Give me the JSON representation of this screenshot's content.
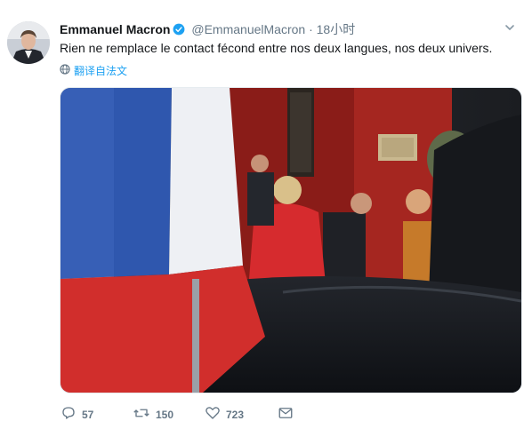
{
  "tweet": {
    "author_name": "Emmanuel Macron",
    "handle": "@EmmanuelMacron",
    "separator": "·",
    "time": "18小时",
    "text": "Rien ne remplace le contact fécond entre nos deux langues, nos deux univers.",
    "translate_label": "翻译自法文"
  },
  "icons": {
    "verified": "verified-badge-icon",
    "menu": "chevron-down-icon",
    "translate": "globe-icon",
    "reply": "reply-icon",
    "retweet": "retweet-icon",
    "like": "heart-icon",
    "message": "envelope-icon"
  },
  "actions": {
    "replies": "57",
    "retweets": "150",
    "likes": "723"
  },
  "colors": {
    "accent": "#1da1f2",
    "muted": "#657786",
    "text": "#14171a"
  }
}
